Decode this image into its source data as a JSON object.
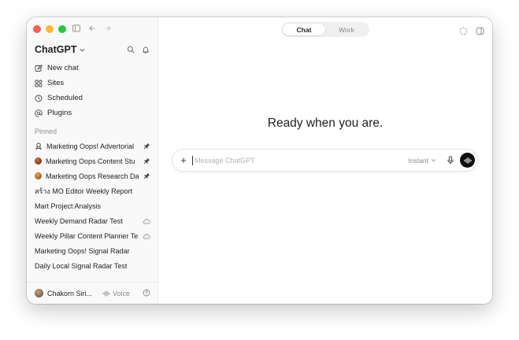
{
  "sidebar": {
    "brand": "ChatGPT",
    "nav": [
      {
        "label": "New chat",
        "icon": "compose-icon"
      },
      {
        "label": "Sites",
        "icon": "sites-icon"
      },
      {
        "label": "Scheduled",
        "icon": "clock-icon"
      },
      {
        "label": "Plugins",
        "icon": "at-icon"
      }
    ],
    "section_label": "Pinned",
    "chats": [
      {
        "title": "Marketing Oops! Advertorial",
        "lead": "gpt-icon",
        "trail": "pin-icon"
      },
      {
        "title": "Marketing Oops Content Stu",
        "lead": "avatar",
        "trail": "pin-icon"
      },
      {
        "title": "Marketing Oops Research Da",
        "lead": "avatar",
        "trail": "pin-icon"
      },
      {
        "title": "สร้าง MO Editor Weekly Report",
        "lead": "",
        "trail": ""
      },
      {
        "title": "Mart Project Analysis",
        "lead": "",
        "trail": ""
      },
      {
        "title": "Weekly Demand Radar Test",
        "lead": "",
        "trail": "cloud-icon"
      },
      {
        "title": "Weekly Pillar Content Planner Te",
        "lead": "",
        "trail": "cloud-icon"
      },
      {
        "title": "Marketing Oops! Signal Radar",
        "lead": "",
        "trail": ""
      },
      {
        "title": "Daily Local Signal Radar Test",
        "lead": "",
        "trail": ""
      }
    ],
    "footer": {
      "user": "Chakorn Siri...",
      "voice_label": "Voice"
    }
  },
  "main": {
    "tabs": [
      {
        "label": "Chat",
        "active": true
      },
      {
        "label": "Work",
        "active": false
      }
    ],
    "headline": "Ready when you are.",
    "composer": {
      "placeholder": "Message ChatGPT",
      "value": "",
      "model": "Instant"
    }
  },
  "colors": {
    "close": "#fe5f57",
    "minimize": "#febc2e",
    "zoom": "#28c840",
    "voice_button": "#0d0d0d"
  }
}
